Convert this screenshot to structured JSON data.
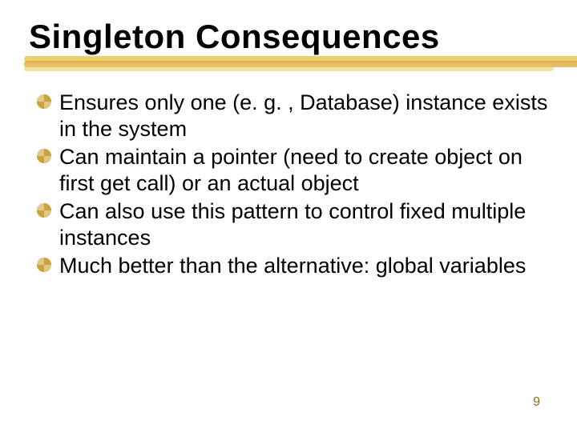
{
  "title": "Singleton Consequences",
  "bullets": [
    "Ensures only one (e. g. , Database) instance exists in the system",
    "Can maintain a pointer (need to create object on first get call) or an actual object",
    "Can also use this pattern to control fixed multiple instances",
    "Much better than the alternative:  global variables"
  ],
  "page_number": "9"
}
